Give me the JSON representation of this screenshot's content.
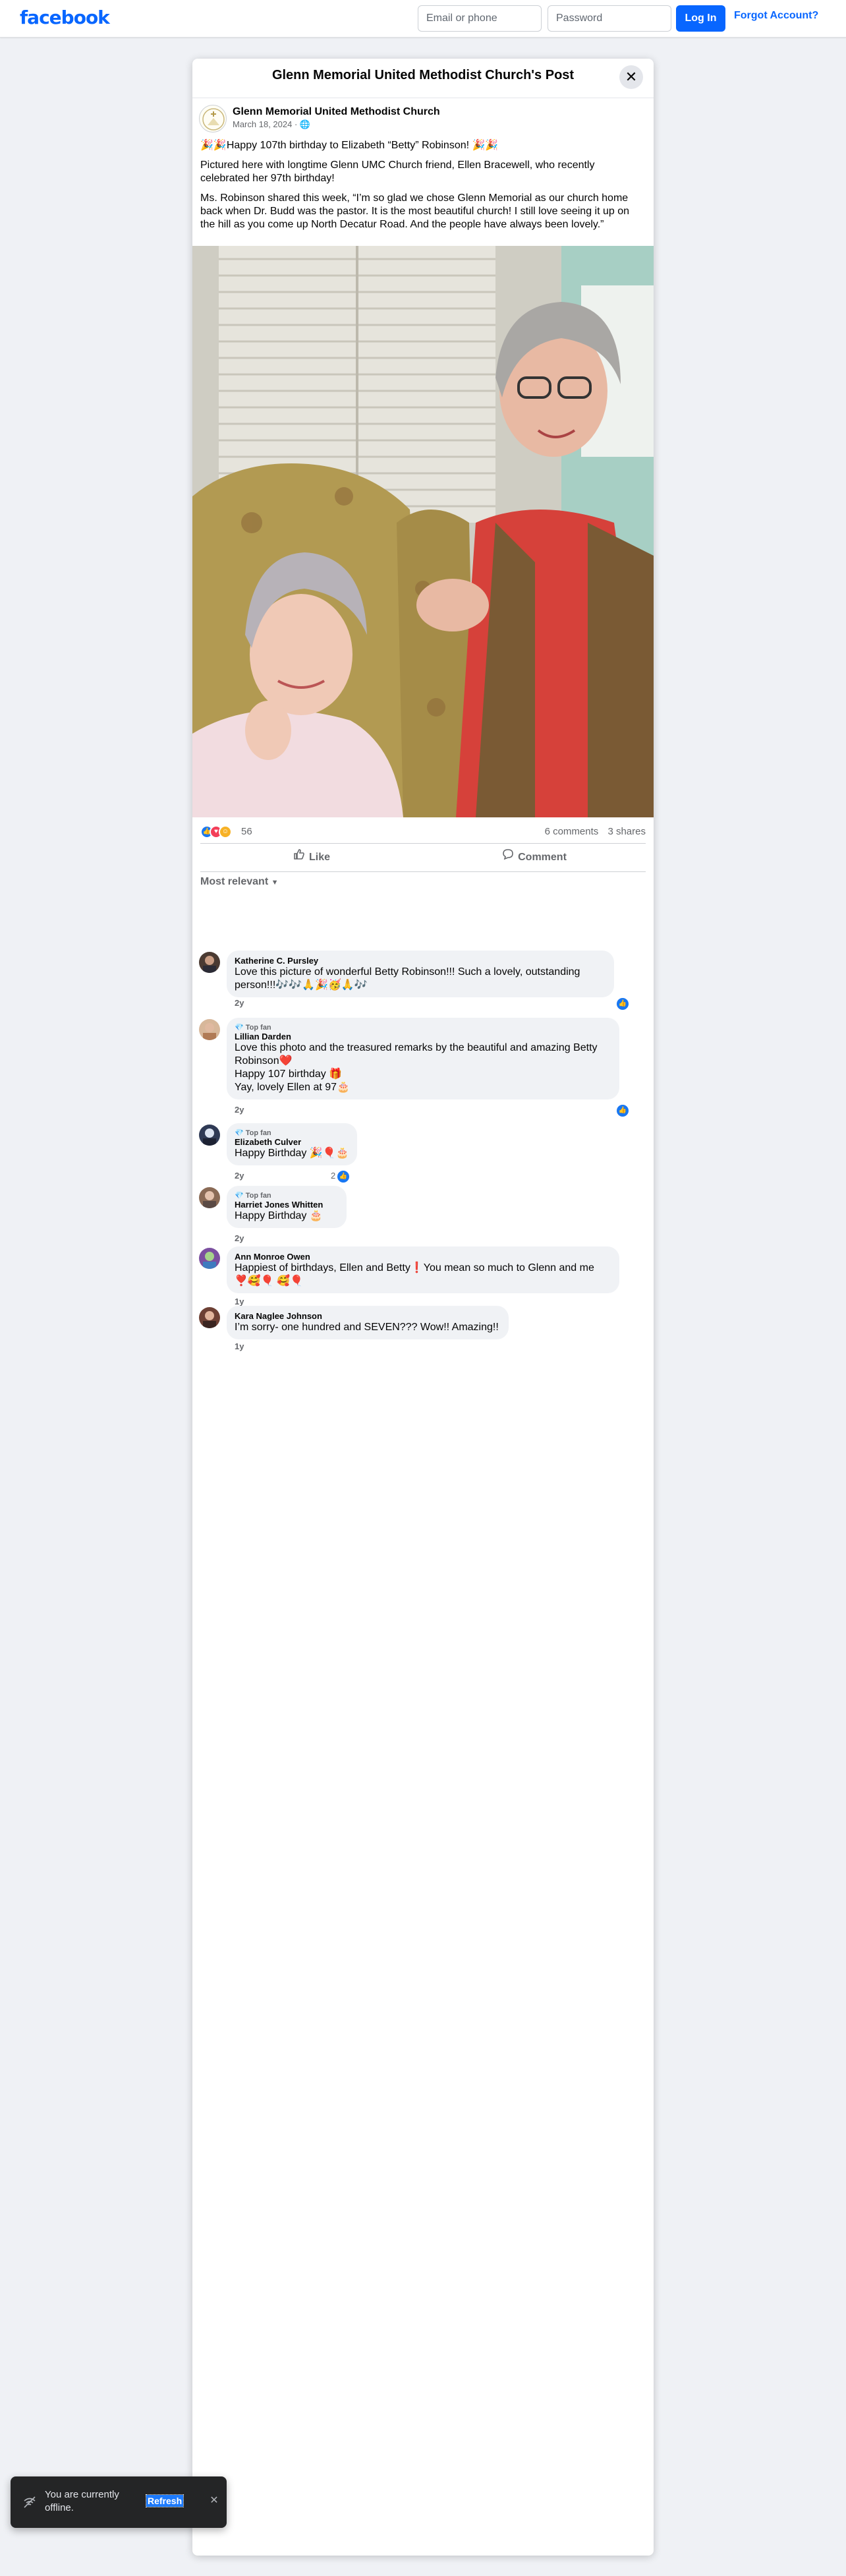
{
  "topbar": {
    "logo": "facebook",
    "email_placeholder": "Email or phone",
    "password_placeholder": "Password",
    "login_label": "Log In",
    "forgot_label": "Forgot Account?"
  },
  "modal": {
    "title": "Glenn Memorial United Methodist Church's Post",
    "close_icon": "close-icon"
  },
  "post": {
    "author": "Glenn Memorial United Methodist Church",
    "date": "March 18, 2024",
    "audience_icon": "globe-icon",
    "paragraphs": [
      "🎉🎉Happy 107th birthday to Elizabeth “Betty” Robinson! 🎉🎉",
      "Pictured here with longtime Glenn UMC Church friend, Ellen Bracewell, who recently celebrated her 97th birthday!",
      "Ms. Robinson shared this week, “I’m so glad we chose Glenn Memorial as our church home back when Dr. Budd was the pastor. It is the most beautiful church! I still love seeing it up on the hill as you come up North Decatur Road. And the people have always been lovely.”"
    ],
    "reactions": {
      "icons": [
        "like-icon",
        "love-icon",
        "care-icon"
      ],
      "colors": {
        "like": "#1877f2",
        "love": "#f33e58",
        "care": "#f7b125"
      },
      "count": "56"
    },
    "comments_count": "6 comments",
    "shares_count": "3 shares",
    "actions": {
      "like": "Like",
      "comment": "Comment"
    },
    "sort_label": "Most relevant"
  },
  "comments": [
    {
      "badge": "",
      "name": "Katherine C. Pursley",
      "lines": [
        "Love this picture of wonderful Betty Robinson!!! Such a lovely, outstanding person!!!🎶🎶🙏🎉🥳🙏🎶"
      ],
      "time": "2y",
      "like_count": ""
    },
    {
      "badge": "💎 Top fan",
      "name": "Lillian Darden",
      "lines": [
        "Love this photo and the treasured remarks by the beautiful and amazing Betty Robinson❤️",
        "Happy 107 birthday 🎁",
        "Yay, lovely Ellen at 97🎂"
      ],
      "time": "2y",
      "like_count": ""
    },
    {
      "badge": "💎 Top fan",
      "name": "Elizabeth Culver",
      "lines": [
        "Happy Birthday 🎉🎈🎂"
      ],
      "time": "2y",
      "like_count": "2"
    },
    {
      "badge": "💎 Top fan",
      "name": "Harriet Jones Whitten",
      "lines": [
        "Happy Birthday 🎂"
      ],
      "time": "2y",
      "like_count": ""
    },
    {
      "badge": "",
      "name": "Ann Monroe Owen",
      "lines": [
        "Happiest of birthdays, Ellen and Betty❗You mean so much to Glenn and me",
        "❣️🥰🎈 🥰🎈"
      ],
      "time": "1y",
      "like_count": ""
    },
    {
      "badge": "",
      "name": "Kara Naglee Johnson",
      "lines": [
        "I’m sorry- one hundred and SEVEN??? Wow!! Amazing!!"
      ],
      "time": "1y",
      "like_count": ""
    }
  ],
  "toast": {
    "message": "You are currently offline.",
    "refresh": "Refresh",
    "close_icon": "close-icon"
  }
}
